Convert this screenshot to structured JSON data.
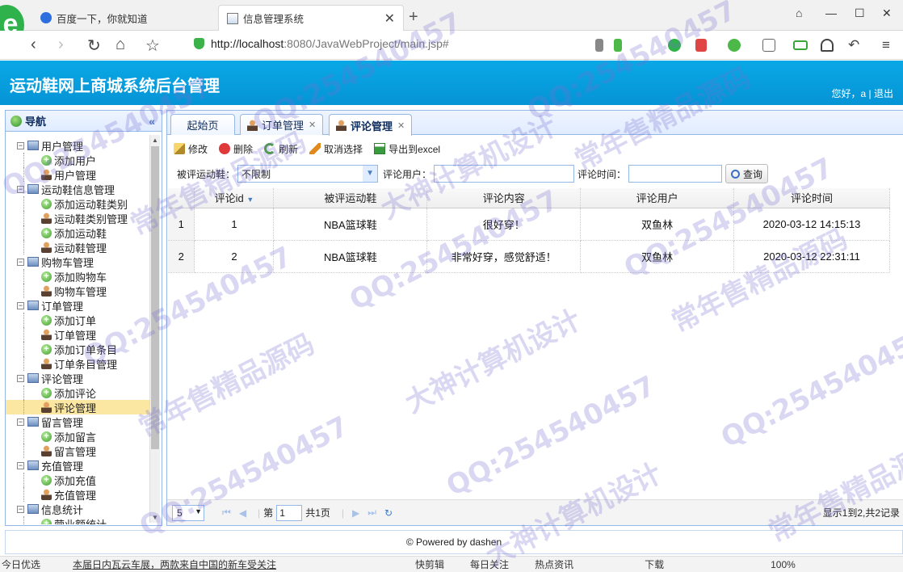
{
  "browser": {
    "tabs": [
      {
        "title": "百度一下，你就知道",
        "active": false
      },
      {
        "title": "信息管理系统",
        "active": true
      }
    ],
    "logo_letter": "e",
    "url_host": "http://localhost",
    "url_rest": ":8080/JavaWebProject/main.jsp#"
  },
  "header": {
    "title": "运动鞋网上商城系统后台管理",
    "greeting": "您好，a",
    "separator": "|",
    "logout": "退出"
  },
  "nav": {
    "title": "导航",
    "tree": [
      {
        "type": "group",
        "label": "用户管理"
      },
      {
        "type": "add",
        "label": "添加用户"
      },
      {
        "type": "manage",
        "label": "用户管理"
      },
      {
        "type": "group",
        "label": "运动鞋信息管理"
      },
      {
        "type": "add",
        "label": "添加运动鞋类别"
      },
      {
        "type": "manage",
        "label": "运动鞋类别管理"
      },
      {
        "type": "add",
        "label": "添加运动鞋"
      },
      {
        "type": "manage",
        "label": "运动鞋管理"
      },
      {
        "type": "group",
        "label": "购物车管理"
      },
      {
        "type": "add",
        "label": "添加购物车"
      },
      {
        "type": "manage",
        "label": "购物车管理"
      },
      {
        "type": "group",
        "label": "订单管理"
      },
      {
        "type": "add",
        "label": "添加订单"
      },
      {
        "type": "manage",
        "label": "订单管理"
      },
      {
        "type": "add",
        "label": "添加订单条目"
      },
      {
        "type": "manage",
        "label": "订单条目管理"
      },
      {
        "type": "group",
        "label": "评论管理"
      },
      {
        "type": "add",
        "label": "添加评论"
      },
      {
        "type": "manage",
        "label": "评论管理",
        "selected": true
      },
      {
        "type": "group",
        "label": "留言管理"
      },
      {
        "type": "add",
        "label": "添加留言"
      },
      {
        "type": "manage",
        "label": "留言管理"
      },
      {
        "type": "group",
        "label": "充值管理"
      },
      {
        "type": "add",
        "label": "添加充值"
      },
      {
        "type": "manage",
        "label": "充值管理"
      },
      {
        "type": "group",
        "label": "信息统计"
      },
      {
        "type": "add",
        "label": "营业额统计"
      }
    ]
  },
  "panel_tabs": {
    "home": "起始页",
    "orders": "订单管理",
    "comments": "评论管理"
  },
  "toolbar": {
    "edit": "修改",
    "delete": "删除",
    "refresh": "刷新",
    "cancel": "取消选择",
    "export": "导出到excel"
  },
  "filters": {
    "shoe_label": "被评运动鞋：",
    "shoe_value": "不限制",
    "user_label": "评论用户：",
    "user_value": "",
    "time_label": "评论时间：",
    "time_value": "",
    "query": "查询"
  },
  "table": {
    "columns": [
      "评论id",
      "被评运动鞋",
      "评论内容",
      "评论用户",
      "评论时间"
    ],
    "rows": [
      {
        "n": "1",
        "id": "1",
        "shoe": "NBA篮球鞋",
        "content": "很好穿！",
        "user": "双鱼林",
        "time": "2020-03-12 14:15:13"
      },
      {
        "n": "2",
        "id": "2",
        "shoe": "NBA篮球鞋",
        "content": "非常好穿，感觉舒适！",
        "user": "双鱼林",
        "time": "2020-03-12 22:31:11"
      }
    ]
  },
  "pager": {
    "page_size": "5",
    "page_prefix": "第",
    "page_value": "1",
    "page_total": "共1页",
    "info": "显示1到2,共2记录"
  },
  "footer": {
    "text": "© Powered by dashen"
  },
  "statusbar": {
    "left": "今日优选",
    "news": "本届日内瓦云车展，两款来自中国的新车受关注",
    "items": [
      "快剪辑",
      "每日关注",
      "热点资讯",
      "下载",
      "100%"
    ]
  },
  "watermarks": [
    "QQ:254540457",
    "常年售精品源码",
    "大神计算机设计"
  ]
}
